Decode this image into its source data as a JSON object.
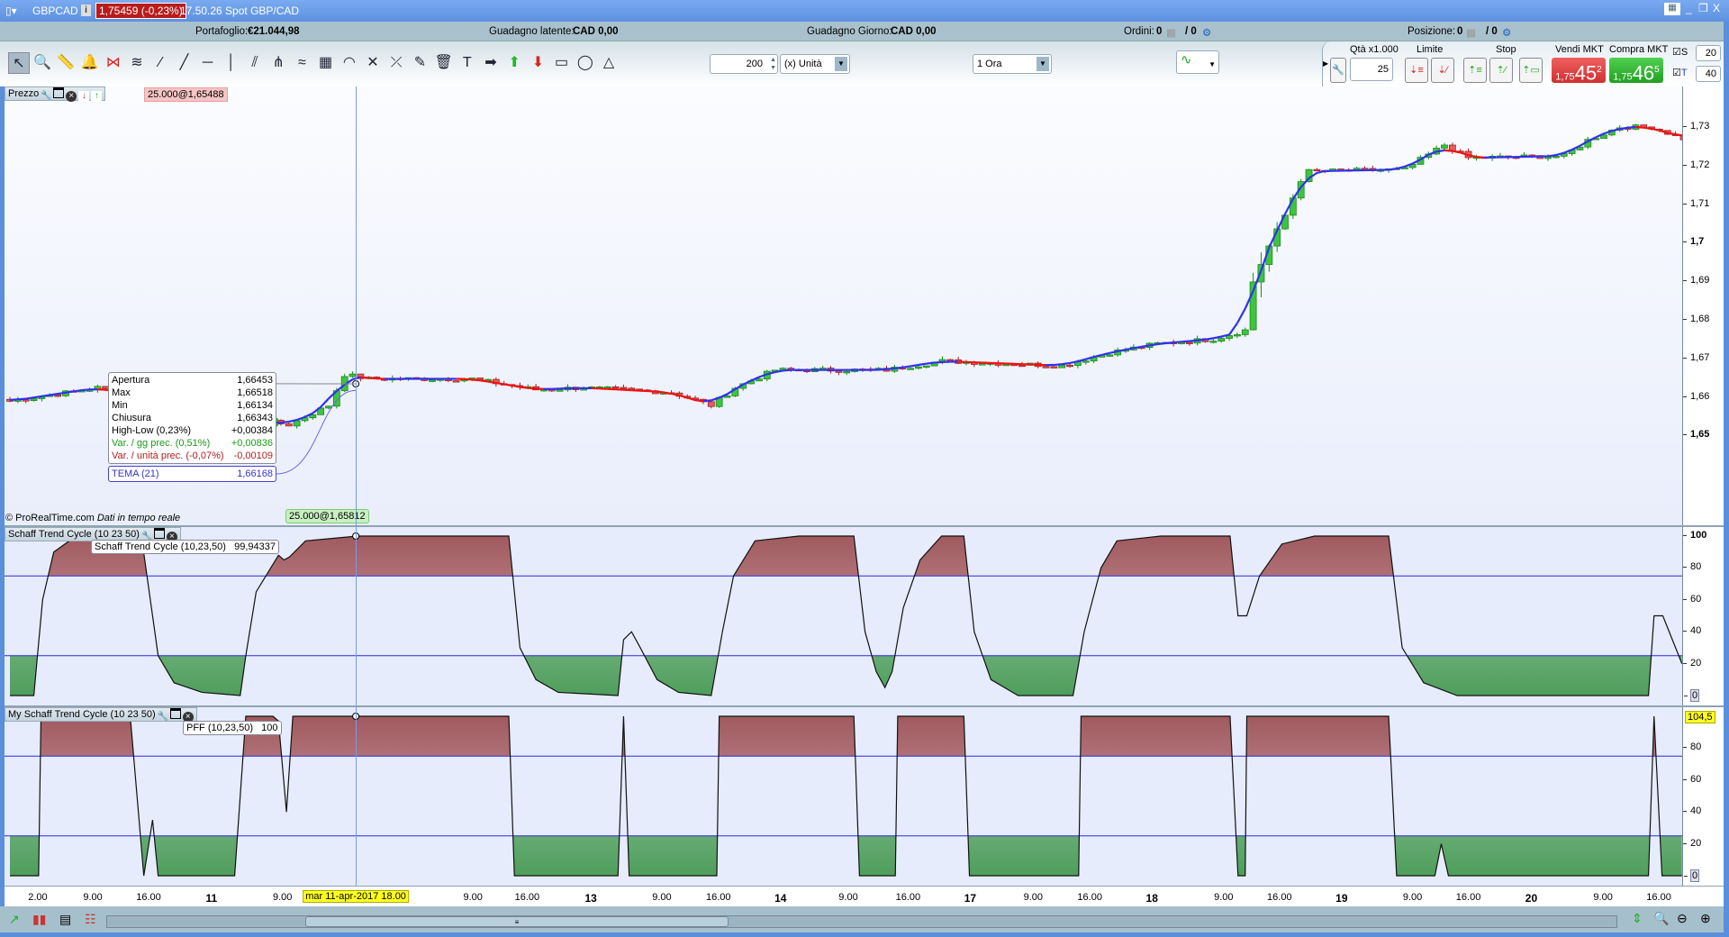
{
  "title": {
    "symbol": "GBPCAD",
    "price_change": "1,75459 (-0,23%)",
    "time_desc": "17.50.26 Spot GBP/CAD"
  },
  "info": {
    "portfolio_label": "Portafoglio:",
    "portfolio": "€21.044,98",
    "latent_label": "Guadagno latente:",
    "latent": "CAD 0,00",
    "day_label": "Guadagno Giorno:",
    "day": "CAD 0,00",
    "orders_label": "Ordini:",
    "orders": "0",
    "orders2": "/ 0",
    "pos_label": "Posizione:",
    "pos": "0",
    "pos2": "/ 0"
  },
  "toolbar": {
    "tools": [
      "pointer",
      "zoom",
      "ruler",
      "alert",
      "fibonacci",
      "fib-fan",
      "segment",
      "line",
      "horizontal-line",
      "vertical-line",
      "channel",
      "pitchfork",
      "regression",
      "gann",
      "arc",
      "trendline-pt",
      "cross-line",
      "tools-settings",
      "trash",
      "text",
      "arrow-right",
      "arrow-up",
      "arrow-down",
      "rectangle",
      "ellipse",
      "triangle"
    ],
    "quantity": "200",
    "unit": "(x) Unità",
    "timeframe": "1 Ora"
  },
  "trade": {
    "qty_label": "Qtà x1.000",
    "qty": "25",
    "limit_label": "Limite",
    "stop_label": "Stop",
    "sell_label": "Vendi MKT",
    "buy_label": "Compra MKT",
    "sell_small": "1,75",
    "sell_big": "45",
    "sell_sup": "2",
    "buy_small": "1,75",
    "buy_big": "46",
    "buy_sup": "5",
    "s_label": "S",
    "s_val": "20",
    "t_label": "T",
    "t_val": "40"
  },
  "price_pane": {
    "title": "Prezzo",
    "order_top": "25.000@1,65488",
    "order_bottom": "25.000@1,65812",
    "copyright": "© ProRealTime.com",
    "realtime": "Dati in tempo reale",
    "tooltip": [
      [
        "Apertura",
        "1,66453"
      ],
      [
        "Max",
        "1,66518"
      ],
      [
        "Min",
        "1,66134"
      ],
      [
        "Chiusura",
        "1,66343"
      ],
      [
        "High-Low (0,23%)",
        "+0,00384"
      ],
      [
        "Var. / gg prec. (0,51%)",
        "+0,00836"
      ],
      [
        "Var. / unità prec. (-0,07%)",
        "-0,00109"
      ]
    ],
    "tema_label": "TEMA (21)",
    "tema_value": "1,66168"
  },
  "stc_pane": {
    "title": "Schaff Trend Cycle (10 23 50)",
    "tip_label": "Schaff Trend Cycle (10,23,50)",
    "tip_value": "99,94337"
  },
  "pff_pane": {
    "title": "My Schaff Trend Cycle (10 23 50)",
    "tip_label": "PFF (10,23,50)",
    "tip_value": "100",
    "axis_marker": "104,5"
  },
  "crosshair_label": "mar 11-apr-2017 18.00",
  "colors": {
    "up": "#3ec43e",
    "down": "#e06060",
    "tema_up": "#3030f0",
    "tema_down": "#f01010"
  },
  "chart_data": [
    {
      "type": "candlestick",
      "candles": 211,
      "crosshair_index": 43.4,
      "close_path": [
        [
          0,
          1.6589
        ],
        [
          11,
          1.6624
        ],
        [
          14,
          1.6612
        ],
        [
          21,
          1.656
        ],
        [
          28,
          1.6548
        ],
        [
          35,
          1.6528
        ],
        [
          40,
          1.6578
        ],
        [
          42,
          1.6658
        ],
        [
          45,
          1.6647
        ],
        [
          58,
          1.6647
        ],
        [
          66,
          1.6619
        ],
        [
          72,
          1.6624
        ],
        [
          83,
          1.6612
        ],
        [
          88,
          1.6578
        ],
        [
          91,
          1.6624
        ],
        [
          96,
          1.667
        ],
        [
          110,
          1.667
        ],
        [
          117,
          1.6693
        ],
        [
          132,
          1.6681
        ],
        [
          138,
          1.6715
        ],
        [
          144,
          1.6738
        ],
        [
          151,
          1.675
        ],
        [
          155,
          1.6773
        ],
        [
          156,
          1.6899
        ],
        [
          158,
          1.6991
        ],
        [
          160,
          1.7071
        ],
        [
          162,
          1.7163
        ],
        [
          163,
          1.7185
        ],
        [
          175,
          1.719
        ],
        [
          180,
          1.7254
        ],
        [
          183,
          1.722
        ],
        [
          195,
          1.7225
        ],
        [
          198,
          1.7266
        ],
        [
          202,
          1.73
        ],
        [
          206,
          1.73
        ],
        [
          210,
          1.727
        ]
      ],
      "ylim": [
        1.65,
        1.735
      ],
      "yticks": [
        "1,65",
        "1,66",
        "1,67",
        "1,68",
        "1,69",
        "1,7",
        "1,71",
        "1,72",
        "1,73"
      ]
    },
    {
      "type": "area",
      "name": "Schaff Trend Cycle",
      "ylim": [
        0,
        100
      ],
      "levels": [
        25,
        75
      ],
      "yticks": [
        "0",
        "20",
        "40",
        "60",
        "80",
        "100"
      ],
      "points": [
        [
          0,
          0
        ],
        [
          3,
          0
        ],
        [
          4.1,
          60
        ],
        [
          5.5,
          90
        ],
        [
          8.3,
          100
        ],
        [
          16.5,
          100
        ],
        [
          18.6,
          25
        ],
        [
          20.6,
          8
        ],
        [
          24.1,
          2
        ],
        [
          28.9,
          0
        ],
        [
          29.6,
          25
        ],
        [
          30.9,
          65
        ],
        [
          33.7,
          88
        ],
        [
          34.4,
          85
        ],
        [
          35.1,
          87
        ],
        [
          37.1,
          97
        ],
        [
          43.6,
          100
        ],
        [
          62.6,
          100
        ],
        [
          64,
          30
        ],
        [
          66,
          10
        ],
        [
          68.8,
          2
        ],
        [
          76.3,
          0
        ],
        [
          77,
          35
        ],
        [
          78,
          40
        ],
        [
          79.1,
          30
        ],
        [
          81.2,
          10
        ],
        [
          83.9,
          2
        ],
        [
          88,
          0
        ],
        [
          89.4,
          40
        ],
        [
          90.8,
          75
        ],
        [
          93.5,
          97
        ],
        [
          99,
          100
        ],
        [
          105.9,
          100
        ],
        [
          107.3,
          40
        ],
        [
          108.7,
          15
        ],
        [
          109.8,
          5
        ],
        [
          110.7,
          15
        ],
        [
          112.1,
          55
        ],
        [
          114.2,
          85
        ],
        [
          116.9,
          100
        ],
        [
          119.7,
          100
        ],
        [
          121,
          40
        ],
        [
          123.1,
          10
        ],
        [
          126.5,
          0
        ],
        [
          133.4,
          0
        ],
        [
          134.8,
          40
        ],
        [
          136.9,
          80
        ],
        [
          138.9,
          97
        ],
        [
          144.4,
          100
        ],
        [
          153.1,
          100
        ],
        [
          154.1,
          50
        ],
        [
          155.2,
          50
        ],
        [
          156.8,
          75
        ],
        [
          159.6,
          95
        ],
        [
          163.7,
          100
        ],
        [
          173,
          100
        ],
        [
          174.7,
          30
        ],
        [
          177.4,
          8
        ],
        [
          181.6,
          0
        ],
        [
          205.6,
          0
        ],
        [
          206.3,
          50
        ],
        [
          207.4,
          50
        ],
        [
          209.8,
          20
        ]
      ]
    },
    {
      "type": "area",
      "name": "PFF",
      "ylim": [
        0,
        104.5
      ],
      "levels": [
        25,
        75
      ],
      "yticks": [
        "0",
        "20",
        "40",
        "60",
        "80"
      ],
      "points": [
        [
          0,
          0
        ],
        [
          3.6,
          0
        ],
        [
          3.9,
          100
        ],
        [
          15.1,
          100
        ],
        [
          16.8,
          0
        ],
        [
          17.9,
          35
        ],
        [
          18.6,
          0
        ],
        [
          28.2,
          0
        ],
        [
          29.6,
          100
        ],
        [
          33,
          100
        ],
        [
          33.7,
          97
        ],
        [
          34.7,
          40
        ],
        [
          35.5,
          100
        ],
        [
          43.6,
          100
        ],
        [
          62.6,
          100
        ],
        [
          63.3,
          0
        ],
        [
          76.3,
          0
        ],
        [
          77,
          100
        ],
        [
          77.7,
          0
        ],
        [
          88.7,
          0
        ],
        [
          89,
          100
        ],
        [
          105.9,
          100
        ],
        [
          106.6,
          0
        ],
        [
          111.1,
          0
        ],
        [
          111.4,
          100
        ],
        [
          119.7,
          100
        ],
        [
          120.4,
          0
        ],
        [
          134.1,
          0
        ],
        [
          134.4,
          100
        ],
        [
          153.1,
          100
        ],
        [
          154.1,
          0
        ],
        [
          155,
          0
        ],
        [
          155.2,
          100
        ],
        [
          173,
          100
        ],
        [
          174,
          0
        ],
        [
          178.8,
          0
        ],
        [
          179.6,
          20
        ],
        [
          180.5,
          0
        ],
        [
          205.6,
          0
        ],
        [
          206.3,
          100
        ],
        [
          207.3,
          0
        ],
        [
          209.8,
          0
        ]
      ]
    }
  ],
  "time_axis": [
    [
      "2.00",
      3.5,
      0
    ],
    [
      "9.00",
      10.4,
      0
    ],
    [
      "16.00",
      17.4,
      0
    ],
    [
      "11",
      25.3,
      1
    ],
    [
      "9.00",
      34.2,
      0
    ],
    [
      "9.00",
      58.1,
      0
    ],
    [
      "16.00",
      64.9,
      0
    ],
    [
      "13",
      72.9,
      1
    ],
    [
      "9.00",
      81.8,
      0
    ],
    [
      "16.00",
      88.9,
      0
    ],
    [
      "14",
      96.7,
      1
    ],
    [
      "9.00",
      105.2,
      0
    ],
    [
      "16.00",
      112.7,
      0
    ],
    [
      "17",
      120.5,
      1
    ],
    [
      "9.00",
      128.4,
      0
    ],
    [
      "16.00",
      135.5,
      0
    ],
    [
      "18",
      143.3,
      1
    ],
    [
      "9.00",
      152.3,
      0
    ],
    [
      "16.00",
      159.3,
      0
    ],
    [
      "19",
      167.1,
      1
    ],
    [
      "9.00",
      176,
      0
    ],
    [
      "16.00",
      183,
      0
    ],
    [
      "20",
      190.9,
      1
    ],
    [
      "9.00",
      199.9,
      0
    ],
    [
      "16.00",
      206.9,
      0
    ]
  ]
}
